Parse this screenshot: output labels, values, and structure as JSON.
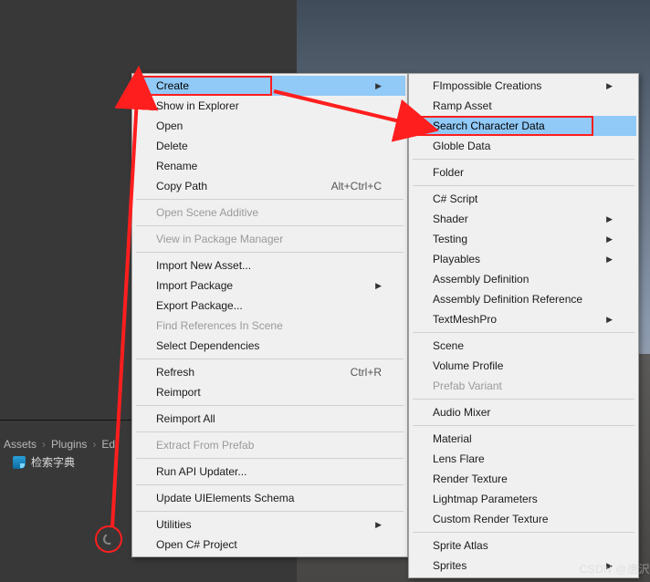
{
  "breadcrumb": {
    "a": "Assets",
    "b": "Plugins",
    "c": "Ed"
  },
  "asset": {
    "name": "检索字典"
  },
  "watermark": "CSDN @唐沢",
  "menu1": {
    "create": "Create",
    "show_in_explorer": "Show in Explorer",
    "open": "Open",
    "delete": "Delete",
    "rename": "Rename",
    "copy_path": "Copy Path",
    "copy_path_sc": "Alt+Ctrl+C",
    "open_scene_additive": "Open Scene Additive",
    "view_in_pkg": "View in Package Manager",
    "import_new_asset": "Import New Asset...",
    "import_package": "Import Package",
    "export_package": "Export Package...",
    "find_refs": "Find References In Scene",
    "select_deps": "Select Dependencies",
    "refresh": "Refresh",
    "refresh_sc": "Ctrl+R",
    "reimport": "Reimport",
    "reimport_all": "Reimport All",
    "extract_prefab": "Extract From Prefab",
    "run_api": "Run API Updater...",
    "update_uielements": "Update UIElements Schema",
    "utilities": "Utilities",
    "open_cs": "Open C# Project"
  },
  "menu2": {
    "fimpossible": "FImpossible Creations",
    "ramp_asset": "Ramp Asset",
    "search_char": "Search Character Data",
    "globle_data": "Globle Data",
    "folder": "Folder",
    "cs_script": "C# Script",
    "shader": "Shader",
    "testing": "Testing",
    "playables": "Playables",
    "asm_def": "Assembly Definition",
    "asm_def_ref": "Assembly Definition Reference",
    "textmeshpro": "TextMeshPro",
    "scene": "Scene",
    "volume_profile": "Volume Profile",
    "prefab_variant": "Prefab Variant",
    "audio_mixer": "Audio Mixer",
    "material": "Material",
    "lens_flare": "Lens Flare",
    "render_texture": "Render Texture",
    "lightmap_params": "Lightmap Parameters",
    "custom_render_texture": "Custom Render Texture",
    "sprite_atlas": "Sprite Atlas",
    "sprites": "Sprites"
  }
}
